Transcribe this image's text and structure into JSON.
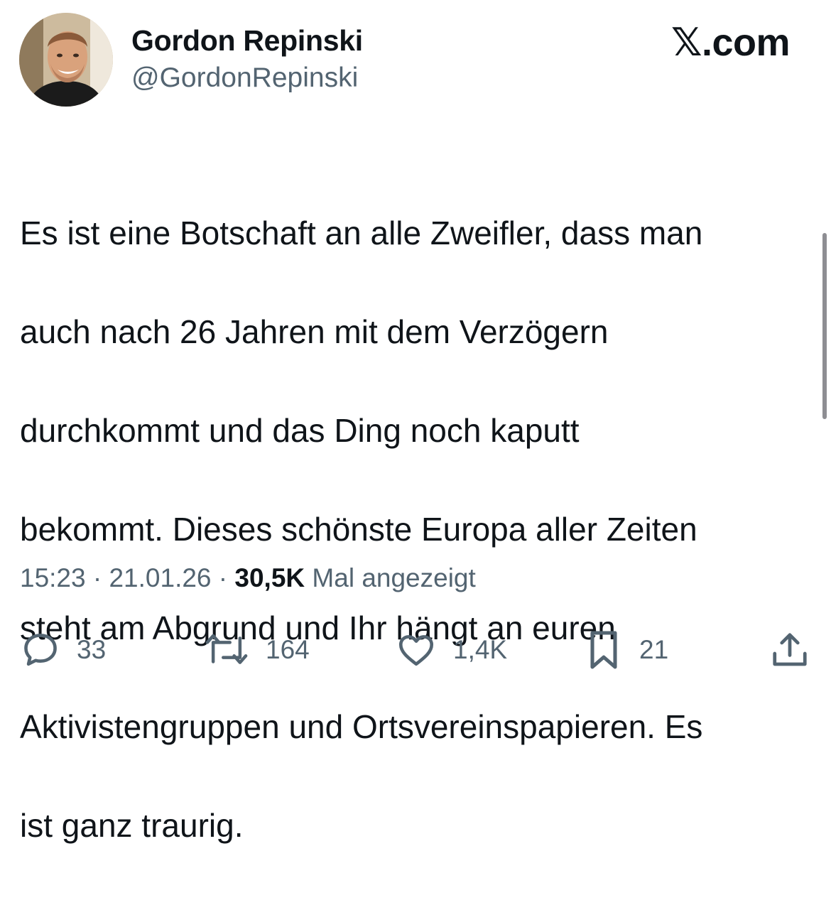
{
  "author": {
    "display_name": "Gordon Repinski",
    "handle": "@GordonRepinski"
  },
  "brand": {
    "label": "𝕏.com"
  },
  "tweet": {
    "lines": [
      "Es ist eine Botschaft an alle Zweifler, dass man",
      "auch nach 26 Jahren mit dem Verzögern",
      "durchkommt und das Ding noch kaputt",
      "bekommt. Dieses schönste Europa aller Zeiten",
      "steht am Abgrund und Ihr hängt an euren",
      "Aktivistengruppen und Ortsvereinspapieren. Es",
      "ist ganz traurig."
    ]
  },
  "meta": {
    "time": "15:23",
    "separator": " · ",
    "date": "21.01.26",
    "views_count": "30,5K",
    "views_label": " Mal angezeigt"
  },
  "actions": {
    "replies": "33",
    "reposts": "164",
    "likes": "1,4K",
    "bookmarks": "21"
  },
  "icons": {
    "reply": "speech-bubble-icon",
    "repost": "repost-arrows-icon",
    "like": "heart-icon",
    "bookmark": "bookmark-icon",
    "share": "share-upload-icon"
  },
  "colors": {
    "text_primary": "#0f1419",
    "text_secondary": "#536471",
    "background": "#ffffff"
  }
}
